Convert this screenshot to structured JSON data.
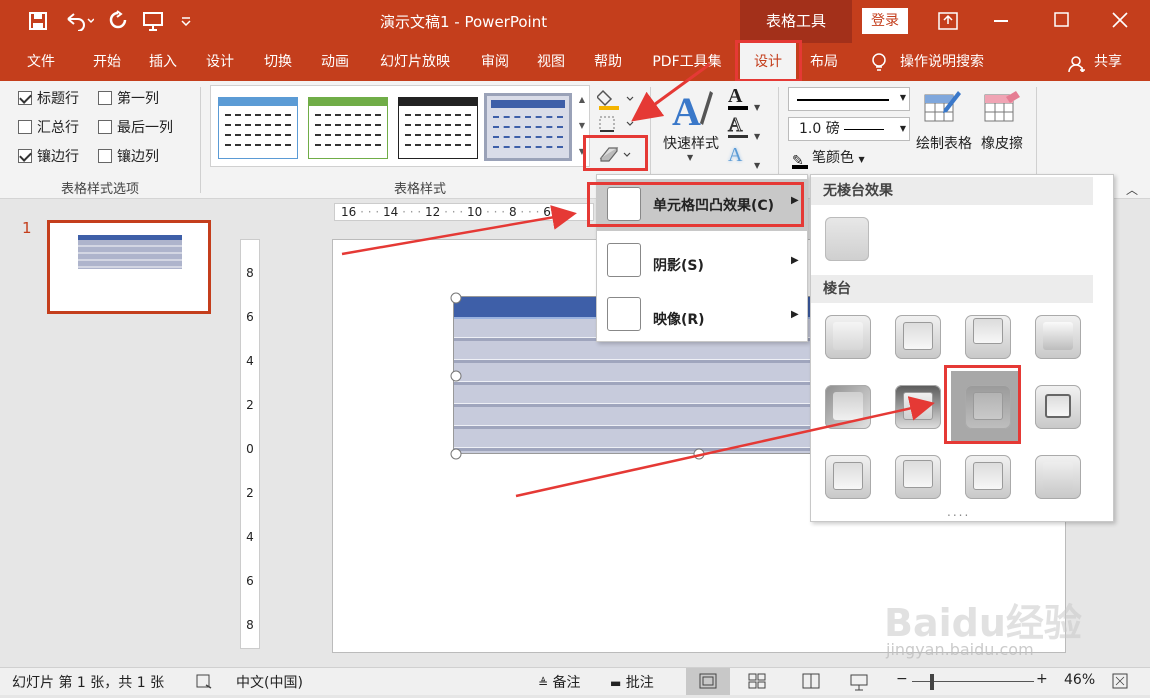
{
  "window": {
    "title": "演示文稿1  -  PowerPoint",
    "context_tab": "表格工具",
    "login": "登录"
  },
  "tabs": [
    "文件",
    "开始",
    "插入",
    "设计",
    "切换",
    "动画",
    "幻灯片放映",
    "审阅",
    "视图",
    "帮助",
    "PDF工具集",
    "设计",
    "布局"
  ],
  "search": "操作说明搜索",
  "share": "共享",
  "ribbon": {
    "style_options": {
      "header_row": "标题行",
      "first_col": "第一列",
      "total_row": "汇总行",
      "last_col": "最后一列",
      "banded_rows": "镶边行",
      "banded_cols": "镶边列",
      "group_label": "表格样式选项"
    },
    "table_styles_label": "表格样式",
    "quick_styles": "快速样式",
    "pen_weight": "1.0 磅",
    "pen_color": "笔颜色",
    "draw_table": "绘制表格",
    "eraser": "橡皮擦"
  },
  "menu": {
    "cell_bevel": "单元格凹凸效果(C)",
    "shadow": "阴影(S)",
    "reflection": "映像(R)"
  },
  "submenu": {
    "no_bevel": "无棱台效果",
    "bevel": "棱台",
    "more": "...."
  },
  "slide_number": "1",
  "ruler_h": [
    "16",
    "14",
    "12",
    "10",
    "8",
    "6"
  ],
  "ruler_v": [
    "8",
    "6",
    "4",
    "2",
    "0",
    "2",
    "4",
    "6",
    "8"
  ],
  "status": {
    "slide_info": "幻灯片 第 1 张，共 1 张",
    "language": "中文(中国)",
    "notes": "备注",
    "comments": "批注",
    "zoom": "46%"
  },
  "watermark": {
    "brand": "Baidu经验",
    "url": "jingyan.baidu.com"
  },
  "colors": {
    "accent": "#c43e1c",
    "annotation_red": "#e53935",
    "table_header": "#3e5fa8",
    "table_body": "#c7cbdc"
  }
}
